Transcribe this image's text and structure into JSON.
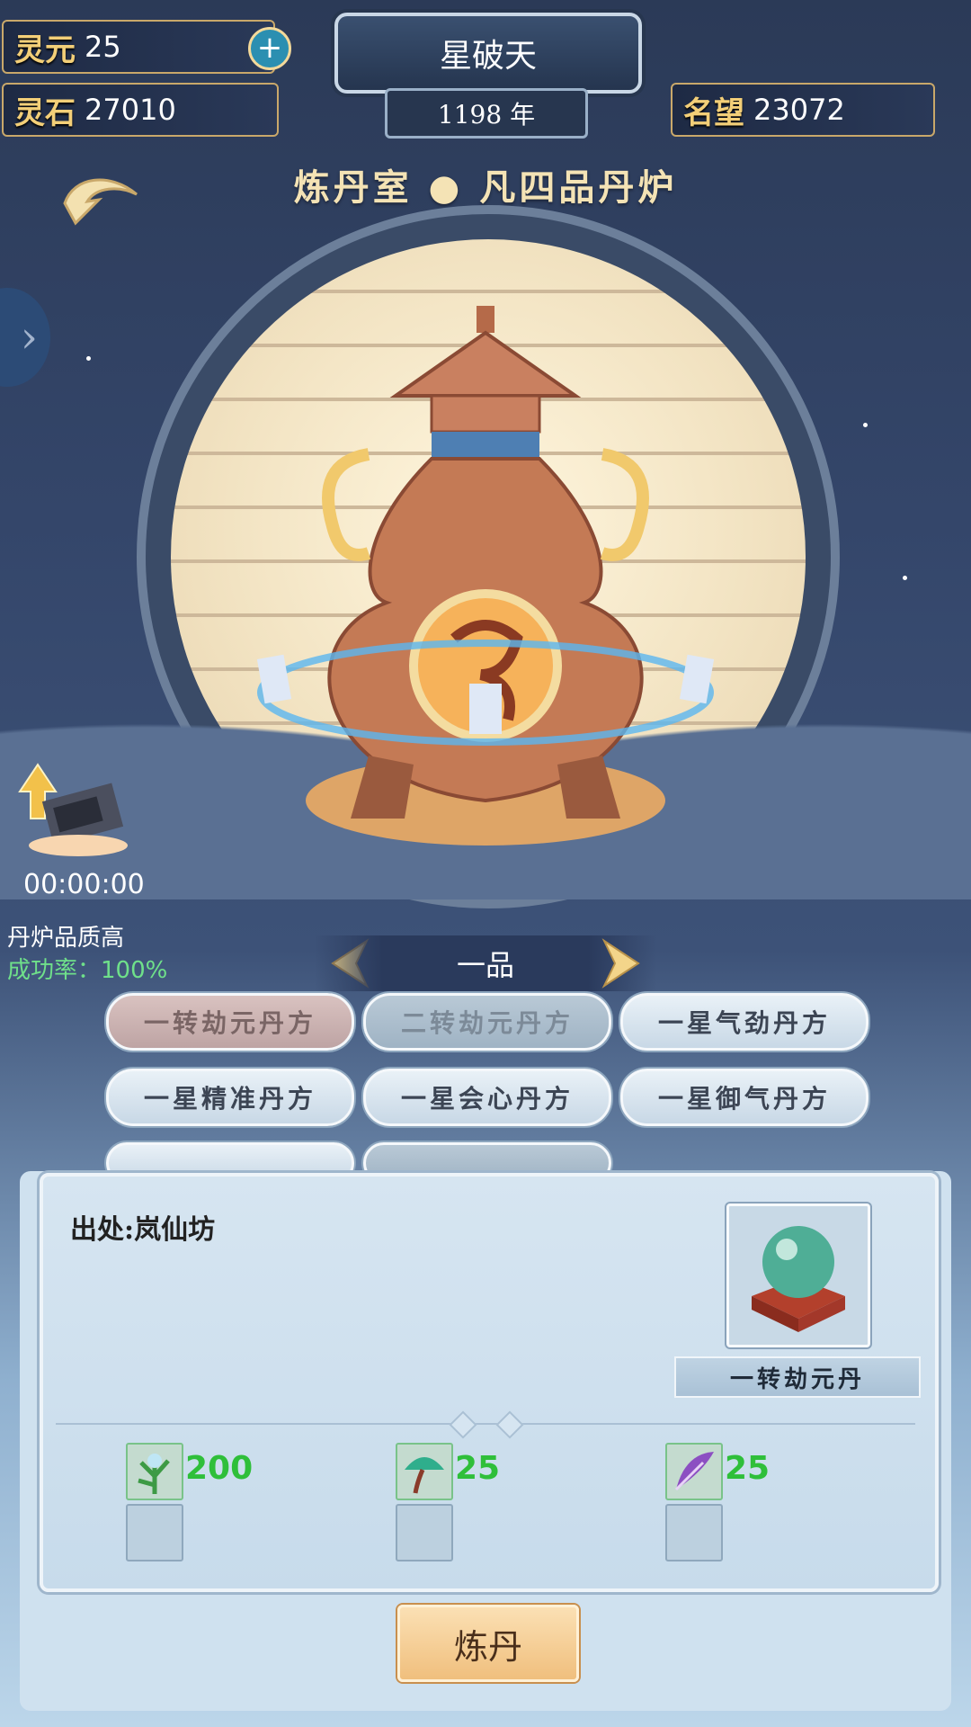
{
  "top": {
    "lingyuan_label": "灵元",
    "lingyuan_value": "25",
    "lingshi_label": "灵石",
    "lingshi_value": "27010",
    "mingwang_label": "名望",
    "mingwang_value": "23072",
    "realm_title": "星破天",
    "year": "1198 年"
  },
  "room_title": "炼丹室 ● 凡四品丹炉",
  "timer": "00:00:00",
  "furnace_status": {
    "quality": "丹炉品质高",
    "rate_label": "成功率：",
    "rate_value": "100%"
  },
  "grade": "一品",
  "recipes": [
    {
      "label": "一转劫元丹方",
      "state": "active"
    },
    {
      "label": "二转劫元丹方",
      "state": "disabled"
    },
    {
      "label": "一星气劲丹方",
      "state": "normal"
    },
    {
      "label": "一星精准丹方",
      "state": "normal"
    },
    {
      "label": "一星会心丹方",
      "state": "normal"
    },
    {
      "label": "一星御气丹方",
      "state": "normal"
    }
  ],
  "panel": {
    "source": "出处:岚仙坊",
    "product_name": "一转劫元丹",
    "materials": [
      {
        "icon": "herb-icon",
        "count": "200",
        "color": "#2fbf3a"
      },
      {
        "icon": "mushroom-icon",
        "count": "25",
        "color": "#2fbf3a"
      },
      {
        "icon": "purple-leaf-icon",
        "count": "25",
        "color": "#2fbf3a"
      }
    ]
  },
  "craft_button": "炼丹",
  "colors": {
    "accent_gold": "#f3cf78",
    "success_green": "#6fe08a"
  }
}
